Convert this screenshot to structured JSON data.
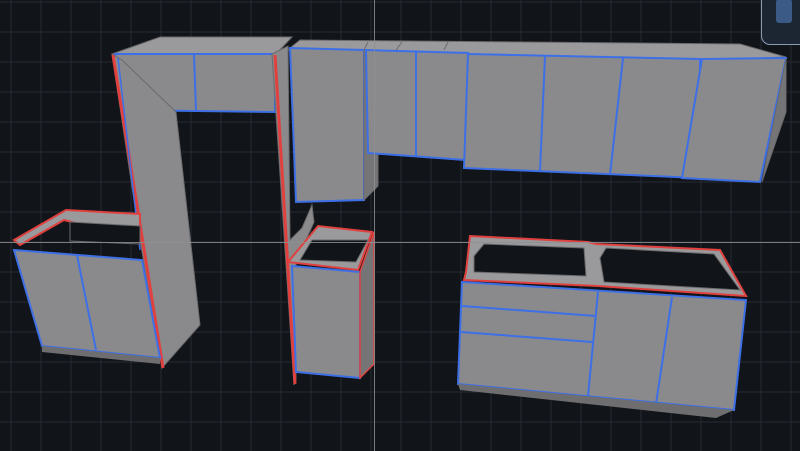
{
  "app": {
    "view": "3D viewport"
  },
  "colors": {
    "background": "#111419",
    "grid": "#262b34",
    "cabinet_fill": "#8a8a8c",
    "cabinet_fill_dark": "#6e6e70",
    "edge_blue": "#3d6fe6",
    "edge_red": "#e0413f",
    "crosshair": "#8d8f93",
    "panel_border": "#8a9bb4"
  },
  "icons": {
    "panel_corner": "view-cube-icon"
  }
}
